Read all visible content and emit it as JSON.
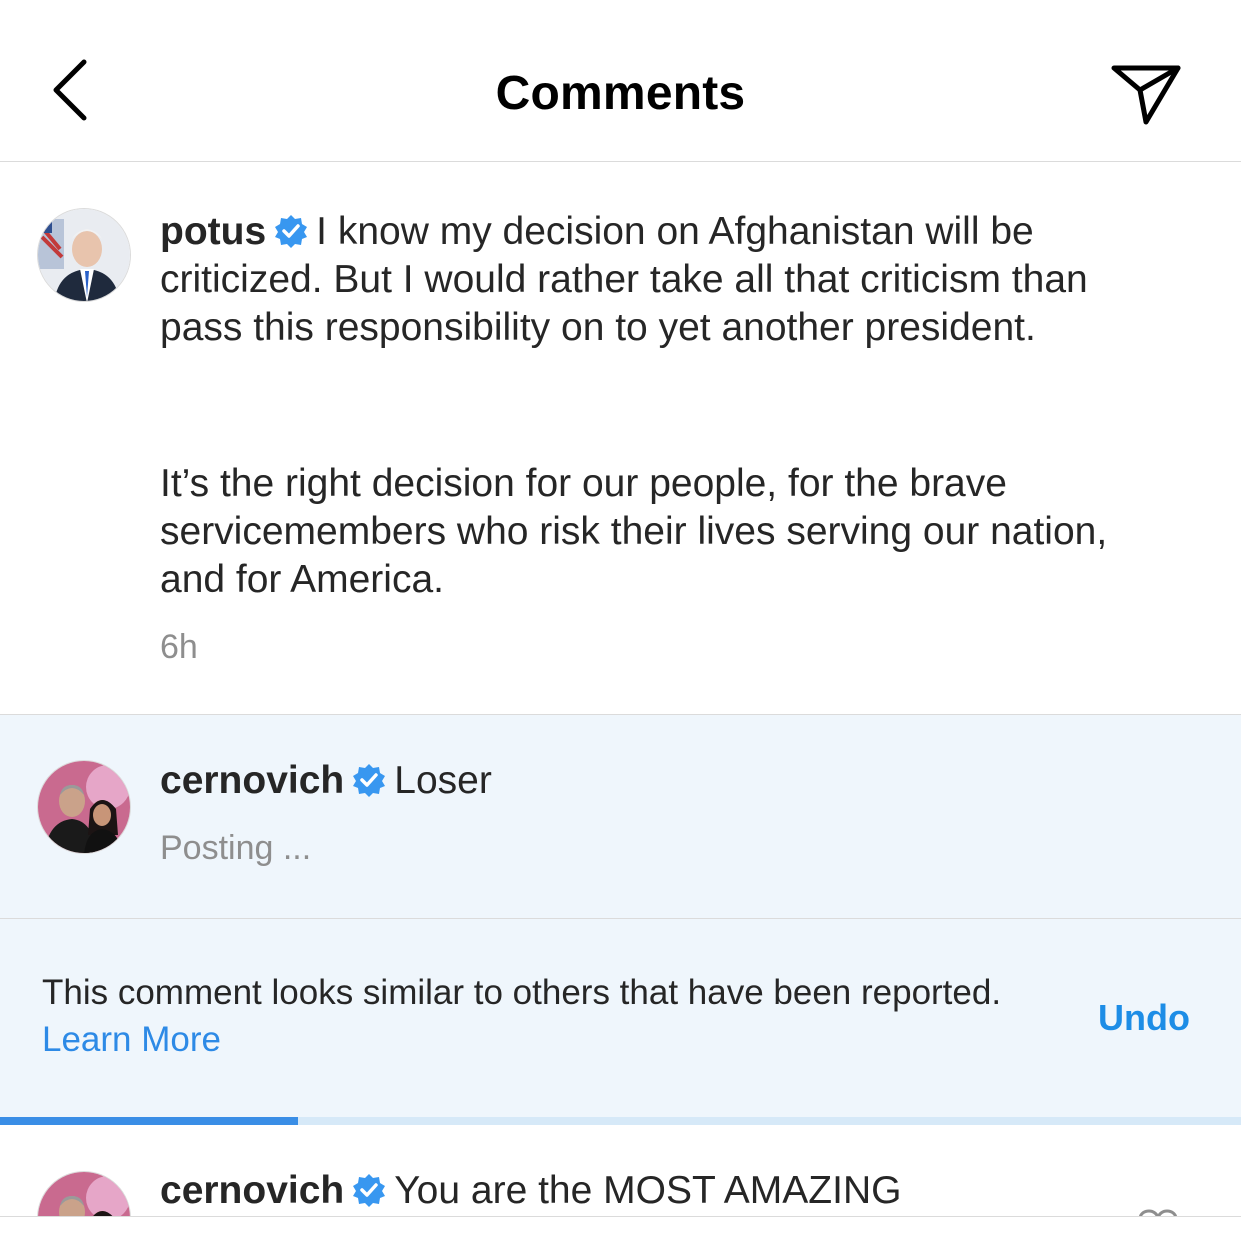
{
  "header": {
    "title": "Comments",
    "back_icon": "chevron-left-icon",
    "send_icon": "paper-plane-icon"
  },
  "caption": {
    "username": "potus",
    "verified_icon": "verified-badge-icon",
    "paragraph1": "I know my decision on Afghanistan will be criticized. But I would rather take all that criticism than pass this responsibility on to yet another president.",
    "paragraph2": "It’s the right decision for our people, for the brave servicemembers who risk their lives serving our nation, and for America.",
    "timestamp": "6h"
  },
  "pending_comment": {
    "username": "cernovich",
    "text": "Loser",
    "status": "Posting ..."
  },
  "notice": {
    "text": "This comment looks similar to others that have been reported.",
    "link": "Learn More",
    "action": "Undo",
    "progress": 0.24
  },
  "next_comment": {
    "username": "cernovich",
    "text": "You are the MOST AMAZING",
    "like_icon": "heart-icon"
  },
  "colors": {
    "verified": "#3897f0",
    "link": "#2d8ae6",
    "pending_bg": "#eff6fc",
    "progress": "#3a8ee6"
  }
}
